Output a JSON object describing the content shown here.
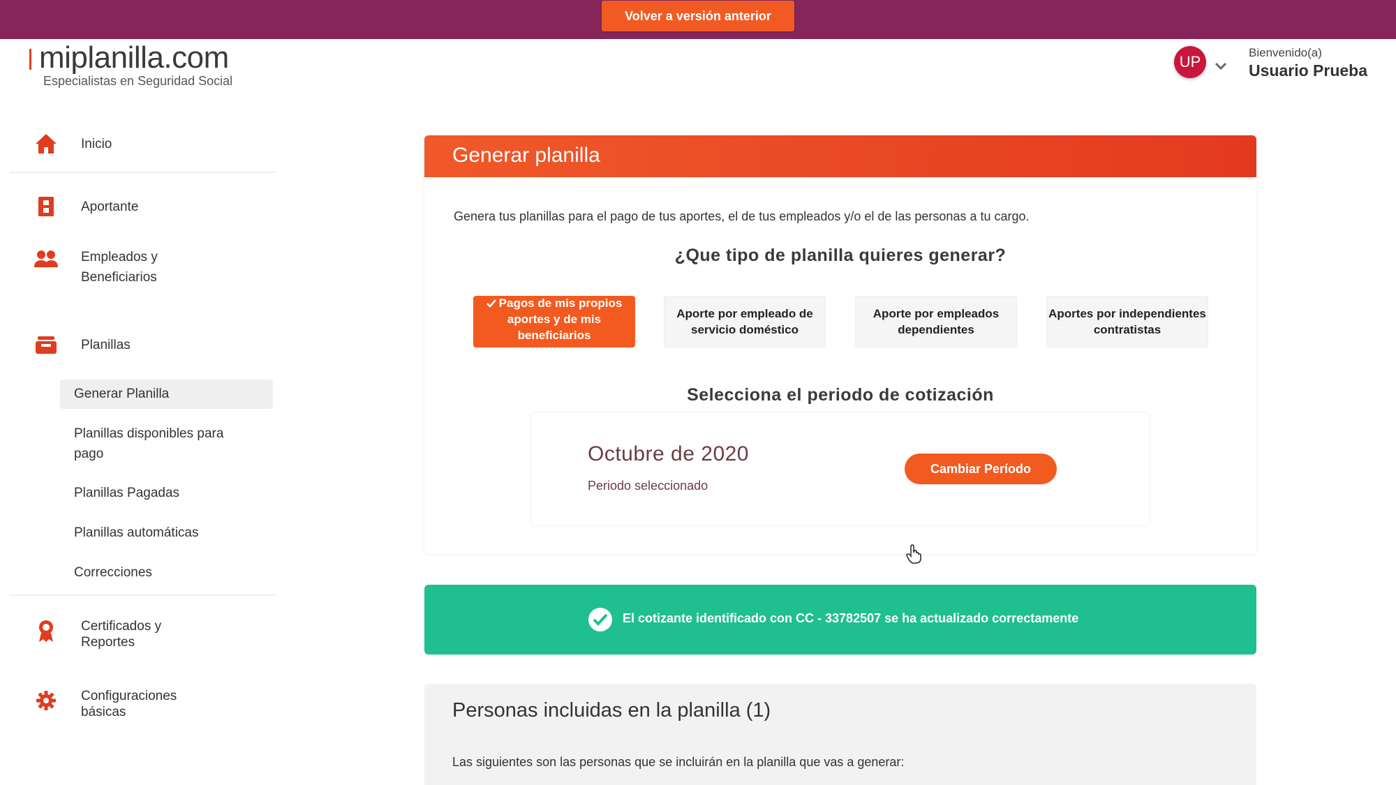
{
  "topbar": {
    "back_label": "Volver a versión anterior"
  },
  "brand": {
    "name": "miplanilla.com",
    "tagline": "Especialistas en Seguridad Social",
    "accent": "#e03c1f"
  },
  "user": {
    "initials": "UP",
    "welcome": "Bienvenido(a)",
    "name": "Usuario Prueba"
  },
  "sidebar": {
    "items": [
      {
        "label": "Inicio",
        "icon": "home-icon"
      },
      {
        "label": "Aportante",
        "icon": "id-badge-icon"
      },
      {
        "label": "Empleados y Beneficiarios",
        "icon": "users-icon"
      },
      {
        "label": "Planillas",
        "icon": "inbox-icon"
      },
      {
        "label": "Certificados y Reportes",
        "icon": "award-icon"
      },
      {
        "label": "Configuraciones básicas",
        "icon": "gear-icon"
      }
    ],
    "subitems": [
      {
        "label": "Generar Planilla",
        "active": true
      },
      {
        "label": "Planillas disponibles para pago"
      },
      {
        "label": "Planillas Pagadas"
      },
      {
        "label": "Planillas automáticas"
      },
      {
        "label": "Correcciones"
      }
    ]
  },
  "main": {
    "title": "Generar planilla",
    "intro": "Genera tus planillas para el pago de tus aportes, el de tus empleados y/o el de las personas a tu cargo.",
    "question": "¿Que tipo de planilla quieres generar?",
    "types": [
      {
        "label": "Pagos de mis propios aportes y de mis beneficiarios",
        "selected": true
      },
      {
        "label": "Aporte por empleado de servicio doméstico"
      },
      {
        "label": "Aporte por empleados dependientes"
      },
      {
        "label": "Aportes por independientes contratistas"
      }
    ],
    "period_title": "Selecciona el periodo de cotización",
    "period_value": "Octubre de 2020",
    "period_note": "Periodo seleccionado",
    "period_button": "Cambiar Período"
  },
  "alert": {
    "message": "El cotizante identificado con CC - 33782507 se ha actualizado correctamente",
    "color": "#1fbf8f"
  },
  "persons": {
    "title": "Personas incluidas en la planilla (1)",
    "description": "Las siguientes son las personas que se incluirán en la planilla que vas a generar:"
  }
}
